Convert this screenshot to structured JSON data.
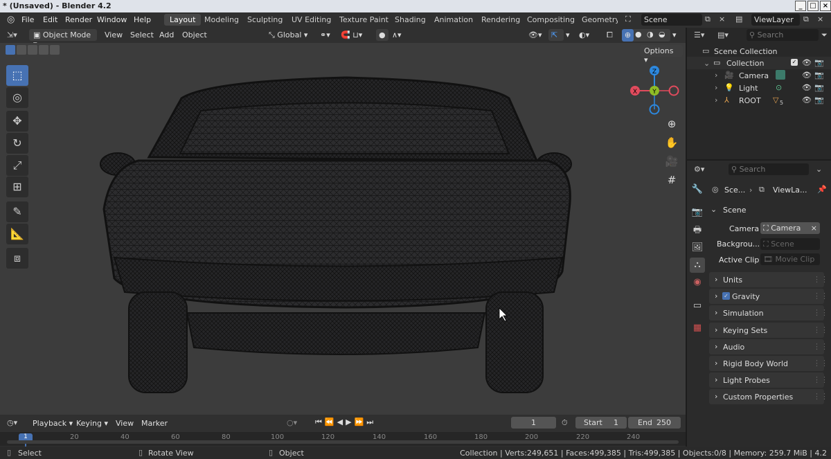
{
  "window": {
    "title": "* (Unsaved) - Blender 4.2"
  },
  "menus": [
    "File",
    "Edit",
    "Render",
    "Window",
    "Help"
  ],
  "workspaces": [
    "Layout",
    "Modeling",
    "Sculpting",
    "UV Editing",
    "Texture Paint",
    "Shading",
    "Animation",
    "Rendering",
    "Compositing",
    "Geometry N"
  ],
  "scene_field": "Scene",
  "viewlayer_field": "ViewLayer",
  "viewport_header": {
    "mode": "Object Mode",
    "menus": [
      "View",
      "Select",
      "Add",
      "Object"
    ],
    "transform": "Global"
  },
  "options_label": "Options",
  "outliner": {
    "search_placeholder": "Search",
    "scene_collection": "Scene Collection",
    "collection": "Collection",
    "items": [
      {
        "name": "Camera"
      },
      {
        "name": "Light"
      },
      {
        "name": "ROOT",
        "badge": "5"
      }
    ]
  },
  "properties": {
    "search_placeholder": "Search",
    "breadcrumb_scene": "Sce...",
    "breadcrumb_viewlayer": "ViewLa...",
    "panel_title": "Scene",
    "camera_label": "Camera",
    "camera_value": "Camera",
    "background_label": "Backgrou...",
    "background_placeholder": "Scene",
    "active_clip_label": "Active Clip",
    "active_clip_placeholder": "Movie Clip",
    "sections": [
      "Units",
      "Gravity",
      "Simulation",
      "Keying Sets",
      "Audio",
      "Rigid Body World",
      "Light Probes",
      "Custom Properties"
    ]
  },
  "timeline": {
    "menus": [
      "Playback",
      "Keying",
      "View",
      "Marker"
    ],
    "current_frame": "1",
    "start_label": "Start",
    "start_value": "1",
    "end_label": "End",
    "end_value": "250",
    "ticks": [
      "1",
      "20",
      "40",
      "60",
      "80",
      "100",
      "120",
      "140",
      "160",
      "180",
      "200",
      "220",
      "240"
    ]
  },
  "statusbar": {
    "select": "Select",
    "rotate": "Rotate View",
    "object": "Object",
    "stats": "Collection | Verts:249,651 | Faces:499,385 | Tris:499,385 | Objects:0/8 | Memory: 259.7 MiB | 4.2"
  },
  "gizmo": {
    "x": "X",
    "y": "Y",
    "z": "Z"
  },
  "colors": {
    "accent": "#4772b3",
    "active_frame": "#4772b3",
    "axis_x": "#e14b5d",
    "axis_y": "#8fbc26",
    "axis_z": "#2d88de"
  }
}
